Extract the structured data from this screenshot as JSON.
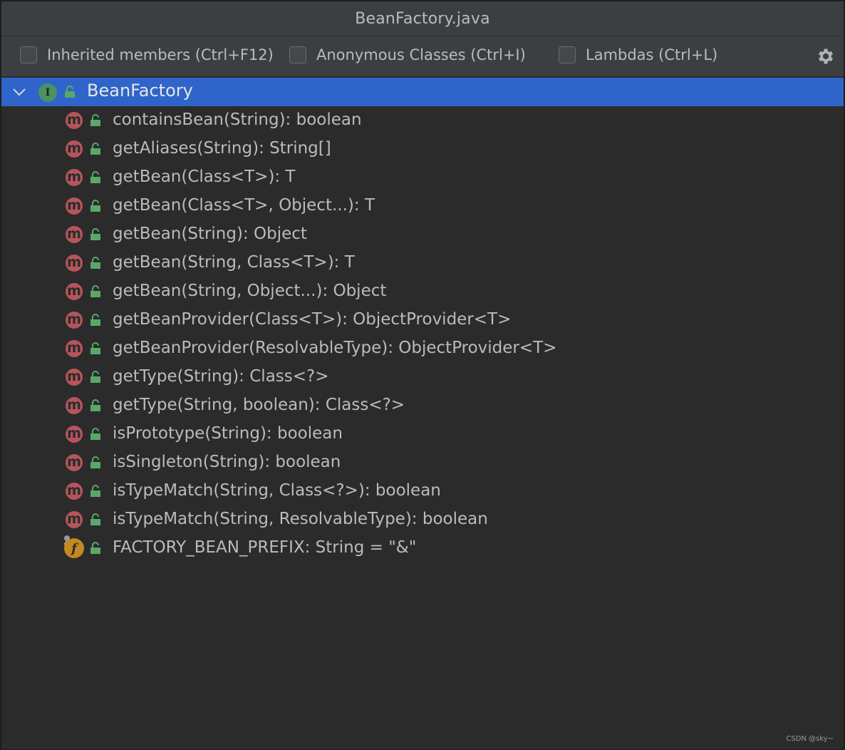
{
  "window": {
    "title": "BeanFactory.java"
  },
  "toolbar": {
    "options": [
      {
        "label": "Inherited members (Ctrl+F12)",
        "checked": false
      },
      {
        "label": "Anonymous Classes (Ctrl+I)",
        "checked": false
      },
      {
        "label": "Lambdas (Ctrl+L)",
        "checked": false
      }
    ],
    "settings_icon": "gear-icon"
  },
  "tree": {
    "root": {
      "label": "BeanFactory",
      "icon": "interface-icon",
      "badge_letter": "I",
      "expanded": true,
      "selected": true
    },
    "members": [
      {
        "kind": "method",
        "badge": "m",
        "label": "containsBean(String): boolean"
      },
      {
        "kind": "method",
        "badge": "m",
        "label": "getAliases(String): String[]"
      },
      {
        "kind": "method",
        "badge": "m",
        "label": "getBean(Class<T>): T"
      },
      {
        "kind": "method",
        "badge": "m",
        "label": "getBean(Class<T>, Object...): T"
      },
      {
        "kind": "method",
        "badge": "m",
        "label": "getBean(String): Object"
      },
      {
        "kind": "method",
        "badge": "m",
        "label": "getBean(String, Class<T>): T"
      },
      {
        "kind": "method",
        "badge": "m",
        "label": "getBean(String, Object...): Object"
      },
      {
        "kind": "method",
        "badge": "m",
        "label": "getBeanProvider(Class<T>): ObjectProvider<T>"
      },
      {
        "kind": "method",
        "badge": "m",
        "label": "getBeanProvider(ResolvableType): ObjectProvider<T>"
      },
      {
        "kind": "method",
        "badge": "m",
        "label": "getType(String): Class<?>"
      },
      {
        "kind": "method",
        "badge": "m",
        "label": "getType(String, boolean): Class<?>"
      },
      {
        "kind": "method",
        "badge": "m",
        "label": "isPrototype(String): boolean"
      },
      {
        "kind": "method",
        "badge": "m",
        "label": "isSingleton(String): boolean"
      },
      {
        "kind": "method",
        "badge": "m",
        "label": "isTypeMatch(String, Class<?>): boolean"
      },
      {
        "kind": "method",
        "badge": "m",
        "label": "isTypeMatch(String, ResolvableType): boolean"
      },
      {
        "kind": "field",
        "badge": "f",
        "label": "FACTORY_BEAN_PREFIX: String = \"&\""
      }
    ]
  },
  "watermark": "CSDN @sky~",
  "colors": {
    "selection": "#2f65ca",
    "method_badge": "#b5555b",
    "field_badge": "#c48a1f",
    "interface_badge": "#4a9163",
    "public_lock": "#59a869"
  }
}
